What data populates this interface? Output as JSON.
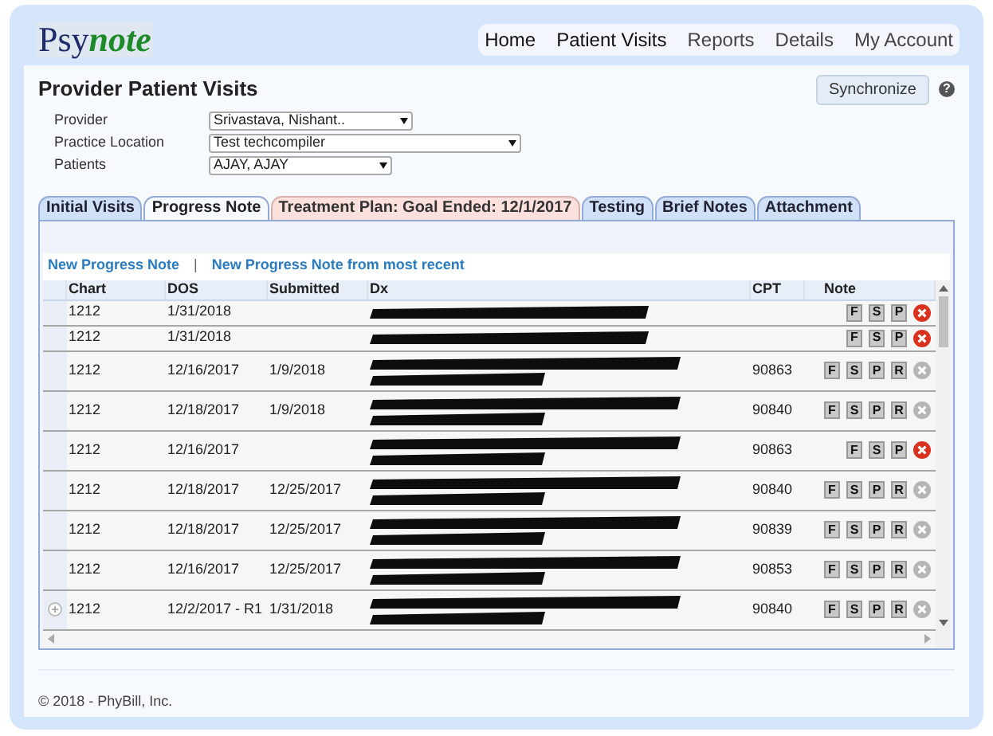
{
  "logo": {
    "text_plain": "Psy",
    "text_styled": "note"
  },
  "nav": [
    {
      "label": "Home",
      "selected": true
    },
    {
      "label": "Patient Visits",
      "selected": true
    },
    {
      "label": "Reports",
      "selected": false
    },
    {
      "label": "Details",
      "selected": false
    },
    {
      "label": "My Account",
      "selected": false
    }
  ],
  "page_title": "Provider Patient Visits",
  "sync_button": "Synchronize",
  "help": "?",
  "filters": [
    {
      "label": "Provider",
      "value": "Srivastava, Nishant.."
    },
    {
      "label": "Practice Location",
      "value": "Test techcompiler"
    },
    {
      "label": "Patients",
      "value": "AJAY, AJAY"
    }
  ],
  "tabs": [
    {
      "label": "Initial Visits",
      "selected": false,
      "highlight": false
    },
    {
      "label": "Progress Note",
      "selected": true,
      "highlight": false
    },
    {
      "label": "Treatment Plan: Goal Ended: 12/1/2017",
      "selected": false,
      "highlight": true
    },
    {
      "label": "Testing",
      "selected": false,
      "highlight": false
    },
    {
      "label": "Brief Notes",
      "selected": false,
      "highlight": false
    },
    {
      "label": "Attachment",
      "selected": false,
      "highlight": false
    }
  ],
  "links": [
    "New Progress Note",
    "New Progress Note from most recent"
  ],
  "link_separator": "|",
  "table": {
    "columns": [
      "Chart",
      "DOS",
      "Submitted",
      "Dx",
      "CPT",
      "Note"
    ],
    "rows": [
      {
        "kind": "short",
        "chart": "1212",
        "dos": "1/31/2018",
        "note_buttons": [
          "F",
          "S",
          "P"
        ],
        "delete_enabled": true,
        "expander": false
      },
      {
        "kind": "short",
        "chart": "1212",
        "dos": "1/31/2018",
        "note_buttons": [
          "F",
          "S",
          "P"
        ],
        "delete_enabled": true,
        "expander": false
      },
      {
        "kind": "tall",
        "chart": "1212",
        "dos": "12/16/2017",
        "submitted": "1/9/2018",
        "cpt": "90863",
        "note_buttons": [
          "F",
          "S",
          "P",
          "R"
        ],
        "delete_enabled": false,
        "expander": false
      },
      {
        "kind": "tall",
        "chart": "1212",
        "dos": "12/18/2017",
        "submitted": "1/9/2018",
        "cpt": "90840",
        "note_buttons": [
          "F",
          "S",
          "P",
          "R"
        ],
        "delete_enabled": false,
        "expander": false
      },
      {
        "kind": "tall",
        "chart": "1212",
        "dos": "12/16/2017",
        "cpt": "90863",
        "note_buttons": [
          "F",
          "S",
          "P"
        ],
        "delete_enabled": true,
        "expander": false
      },
      {
        "kind": "tall",
        "chart": "1212",
        "dos": "12/18/2017",
        "submitted": "12/25/2017",
        "cpt": "90840",
        "note_buttons": [
          "F",
          "S",
          "P",
          "R"
        ],
        "delete_enabled": false,
        "expander": false
      },
      {
        "kind": "tall",
        "chart": "1212",
        "dos": "12/18/2017",
        "submitted": "12/25/2017",
        "cpt": "90839",
        "note_buttons": [
          "F",
          "S",
          "P",
          "R"
        ],
        "delete_enabled": false,
        "expander": false
      },
      {
        "kind": "tall",
        "chart": "1212",
        "dos": "12/16/2017",
        "submitted": "12/25/2017",
        "cpt": "90853",
        "note_buttons": [
          "F",
          "S",
          "P",
          "R"
        ],
        "delete_enabled": false,
        "expander": false
      },
      {
        "kind": "tall",
        "chart": "1212",
        "dos": "12/2/2017 - R1",
        "submitted": "1/31/2018",
        "cpt": "90840",
        "note_buttons": [
          "F",
          "S",
          "P",
          "R"
        ],
        "delete_enabled": false,
        "expander": true
      }
    ]
  },
  "footer": "© 2018 - PhyBill, Inc."
}
